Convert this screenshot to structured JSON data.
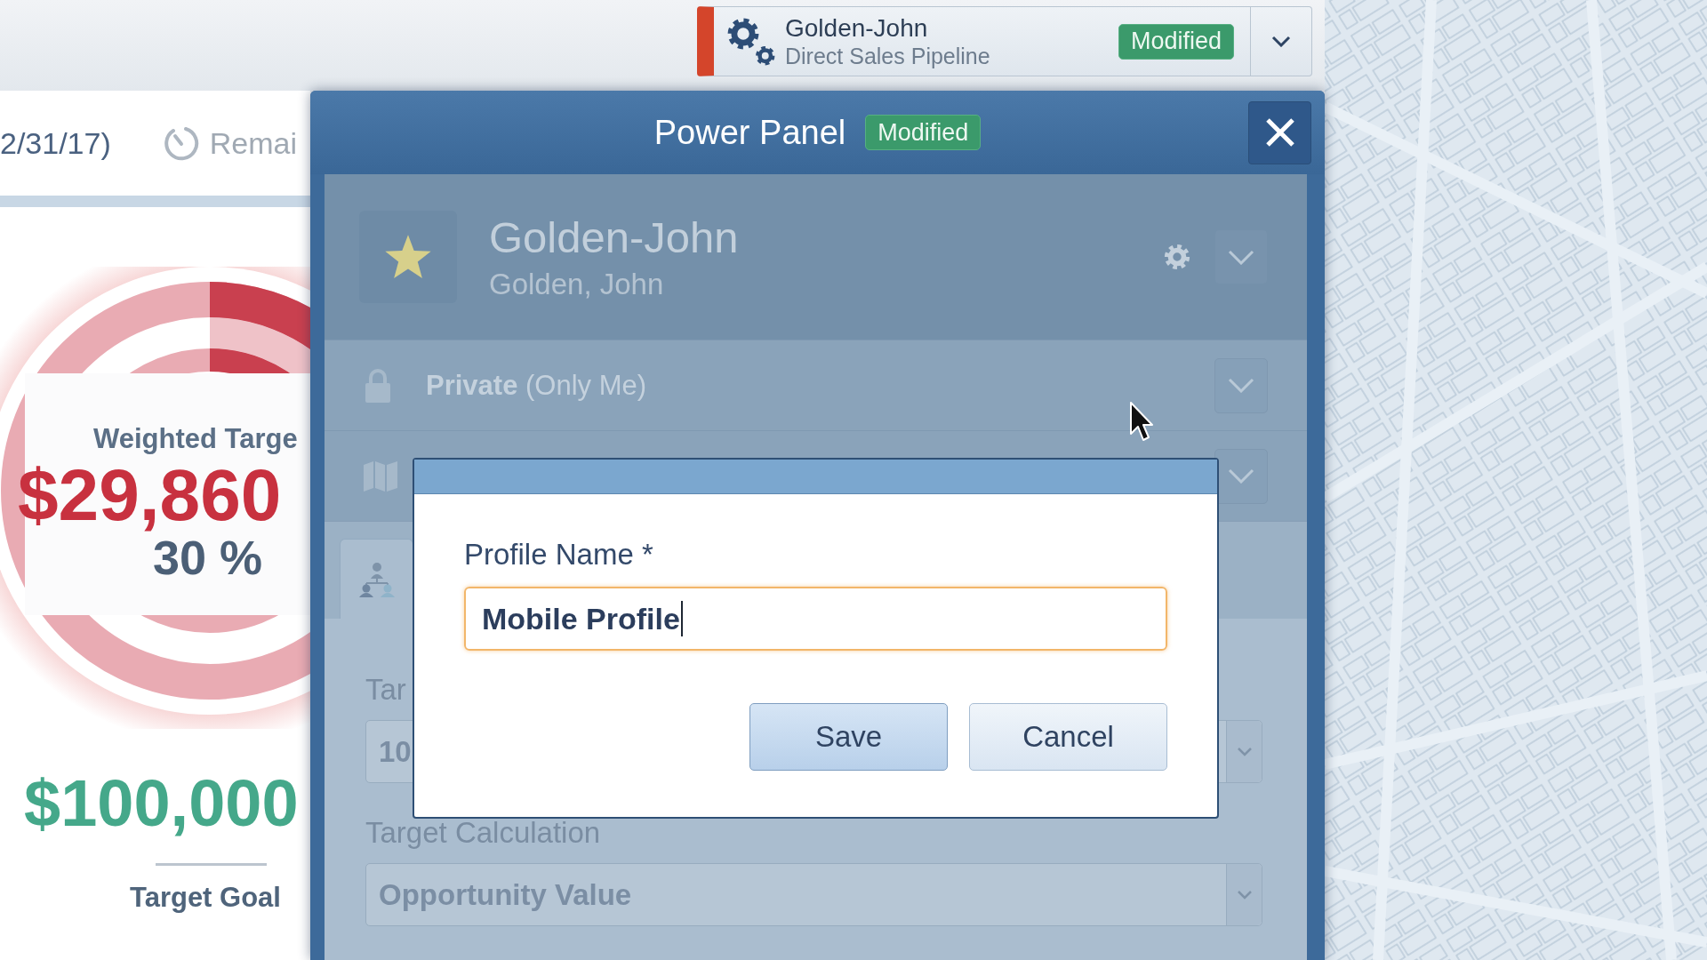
{
  "top_bar": {
    "pipeline_selector": {
      "owner": "Golden-John",
      "pipeline": "Direct Sales Pipeline",
      "badge": "Modified"
    }
  },
  "summary_panel": {
    "header": {
      "date_range": "2/31/17)",
      "remaining": "Remai"
    },
    "gauge": {
      "label": "Weighted Targe",
      "value": "$29,860",
      "percent": "30 %"
    },
    "goal": {
      "value": "$100,000",
      "label": "Target Goal"
    }
  },
  "power_panel": {
    "title": "Power Panel",
    "badge": "Modified",
    "profile": {
      "name": "Golden-John",
      "full_name": "Golden, John",
      "starred": true
    },
    "privacy": "**Private** (Only Me)",
    "tabs": [
      {
        "selected": true
      }
    ],
    "fields": [
      {
        "label": "Tar",
        "value": "10"
      },
      {
        "label": "Target Calculation",
        "value": "Opportunity Value"
      }
    ],
    "dialog": {
      "field_label": "Profile Name *",
      "value": "Mobile Profile",
      "focused": true,
      "buttons": [
        {
          "label": "Save",
          "kind": "primary"
        },
        {
          "label": "Cancel",
          "kind": "secondary"
        }
      ]
    }
  }
}
